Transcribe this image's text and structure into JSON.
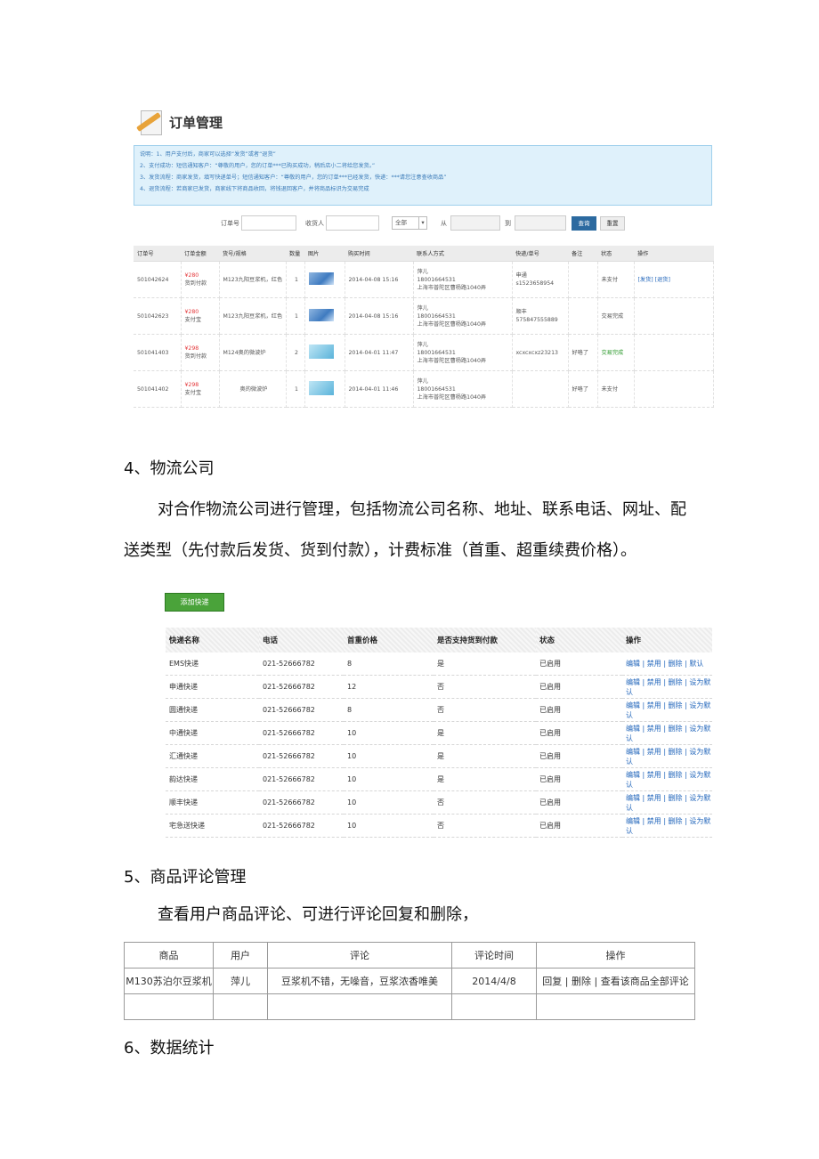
{
  "order_mgmt": {
    "title": "订单管理",
    "notice": [
      "说明：1、用户支付后，商家可以选择“发货”或者“退货”",
      "2、支付成功：短信通知客户：“尊敬的用户，您的订单***已购买成功，稍后店小二将给您发货。”",
      "3、发货流程：商家发货，填写快递单号；短信通知客户：“尊敬的用户，您的订单***已经发货，快递：***请您注意查收商品”",
      "4、退货流程：若商家已发货，商家线下将商品收回，将钱退回客户，并将商品标识为交易完成"
    ],
    "search": {
      "order_no_label": "订单号",
      "receiver_label": "收货人",
      "status_select": "全部",
      "from_label": "从",
      "to_label": "到",
      "query_btn": "查询",
      "reset_btn": "重置"
    },
    "headers": [
      "订单号",
      "订单金额",
      "货号/规格",
      "数量",
      "图片",
      "购买时间",
      "联系人方式",
      "快递/单号",
      "备注",
      "状态",
      "操作"
    ],
    "rows": [
      {
        "id": "501042624",
        "price": "¥280",
        "pay": "货到付款",
        "item": "M123九阳豆浆机，红色",
        "qty": "1",
        "time": "2014-04-08 15:16",
        "contact": "萍儿",
        "phone": "18001664531",
        "addr": "上海市普陀区曹杨路1040弄",
        "courier": "申通",
        "courier_no": "s1523658954",
        "remark": "",
        "status": "未支付",
        "ops": [
          "[发货]",
          "[退货]"
        ]
      },
      {
        "id": "501042623",
        "price": "¥280",
        "pay": "支付宝",
        "item": "M123九阳豆浆机，红色",
        "qty": "1",
        "time": "2014-04-08 15:16",
        "contact": "萍儿",
        "phone": "18001664531",
        "addr": "上海市普陀区曹杨路1040弄",
        "courier": "顺丰",
        "courier_no": "575847555889",
        "remark": "",
        "status": "交易完成",
        "ops": []
      },
      {
        "id": "501041403",
        "price": "¥298",
        "pay": "货到付款",
        "item": "M124奥的微波炉",
        "qty": "2",
        "time": "2014-04-01 11:47",
        "contact": "萍儿",
        "phone": "18001664531",
        "addr": "上海市普陀区曹杨路1040弄",
        "courier": "xcxcxcxz23213",
        "courier_no": "",
        "remark": "好咯了",
        "status": "交易完成",
        "ops": []
      },
      {
        "id": "501041402",
        "price": "¥298",
        "pay": "支付宝",
        "item": "奥的微波炉",
        "qty": "1",
        "time": "2014-04-01 11:46",
        "contact": "萍儿",
        "phone": "18001664531",
        "addr": "上海市普陀区曹杨路1040弄",
        "courier": "",
        "courier_no": "",
        "remark": "好咯了",
        "status": "未支付",
        "ops": []
      }
    ]
  },
  "section4": {
    "heading": "4、物流公司",
    "para1": "对合作物流公司进行管理，包括物流公司名称、地址、联系电话、网址、配",
    "para2": "送类型（先付款后发货、货到付款），计费标准（首重、超重续费价格）。",
    "add_btn": "添加快递",
    "headers": [
      "快递名称",
      "电话",
      "首重价格",
      "是否支持货到付款",
      "状态",
      "操作"
    ],
    "rows": [
      {
        "name": "EMS快递",
        "phone": "021-52666782",
        "price": "8",
        "cod": "是",
        "status": "已启用",
        "ops": "编辑 | 禁用 | 删除 | 默认"
      },
      {
        "name": "申通快递",
        "phone": "021-52666782",
        "price": "12",
        "cod": "否",
        "status": "已启用",
        "ops": "编辑 | 禁用 | 删除 | 设为默认"
      },
      {
        "name": "圆通快递",
        "phone": "021-52666782",
        "price": "8",
        "cod": "否",
        "status": "已启用",
        "ops": "编辑 | 禁用 | 删除 | 设为默认"
      },
      {
        "name": "中通快递",
        "phone": "021-52666782",
        "price": "10",
        "cod": "是",
        "status": "已启用",
        "ops": "编辑 | 禁用 | 删除 | 设为默认"
      },
      {
        "name": "汇通快递",
        "phone": "021-52666782",
        "price": "10",
        "cod": "是",
        "status": "已启用",
        "ops": "编辑 | 禁用 | 删除 | 设为默认"
      },
      {
        "name": "韵达快递",
        "phone": "021-52666782",
        "price": "10",
        "cod": "是",
        "status": "已启用",
        "ops": "编辑 | 禁用 | 删除 | 设为默认"
      },
      {
        "name": "顺丰快递",
        "phone": "021-52666782",
        "price": "10",
        "cod": "否",
        "status": "已启用",
        "ops": "编辑 | 禁用 | 删除 | 设为默认"
      },
      {
        "name": "宅急送快递",
        "phone": "021-52666782",
        "price": "10",
        "cod": "否",
        "status": "已启用",
        "ops": "编辑 | 禁用 | 删除 | 设为默认"
      }
    ]
  },
  "section5": {
    "heading": "5、商品评论管理",
    "para": "查看用户商品评论、可进行评论回复和删除，",
    "headers": [
      "商品",
      "用户",
      "评论",
      "评论时间",
      "操作"
    ],
    "rows": [
      {
        "product": "M130苏泊尔豆浆机",
        "user": "萍儿",
        "comment": "豆浆机不错，无噪音，豆浆浓香唯美",
        "time": "2014/4/8",
        "ops": "回复 | 删除 | 查看该商品全部评论"
      },
      {
        "product": "",
        "user": "",
        "comment": "",
        "time": "",
        "ops": ""
      }
    ]
  },
  "section6": {
    "heading": "6、数据统计"
  }
}
